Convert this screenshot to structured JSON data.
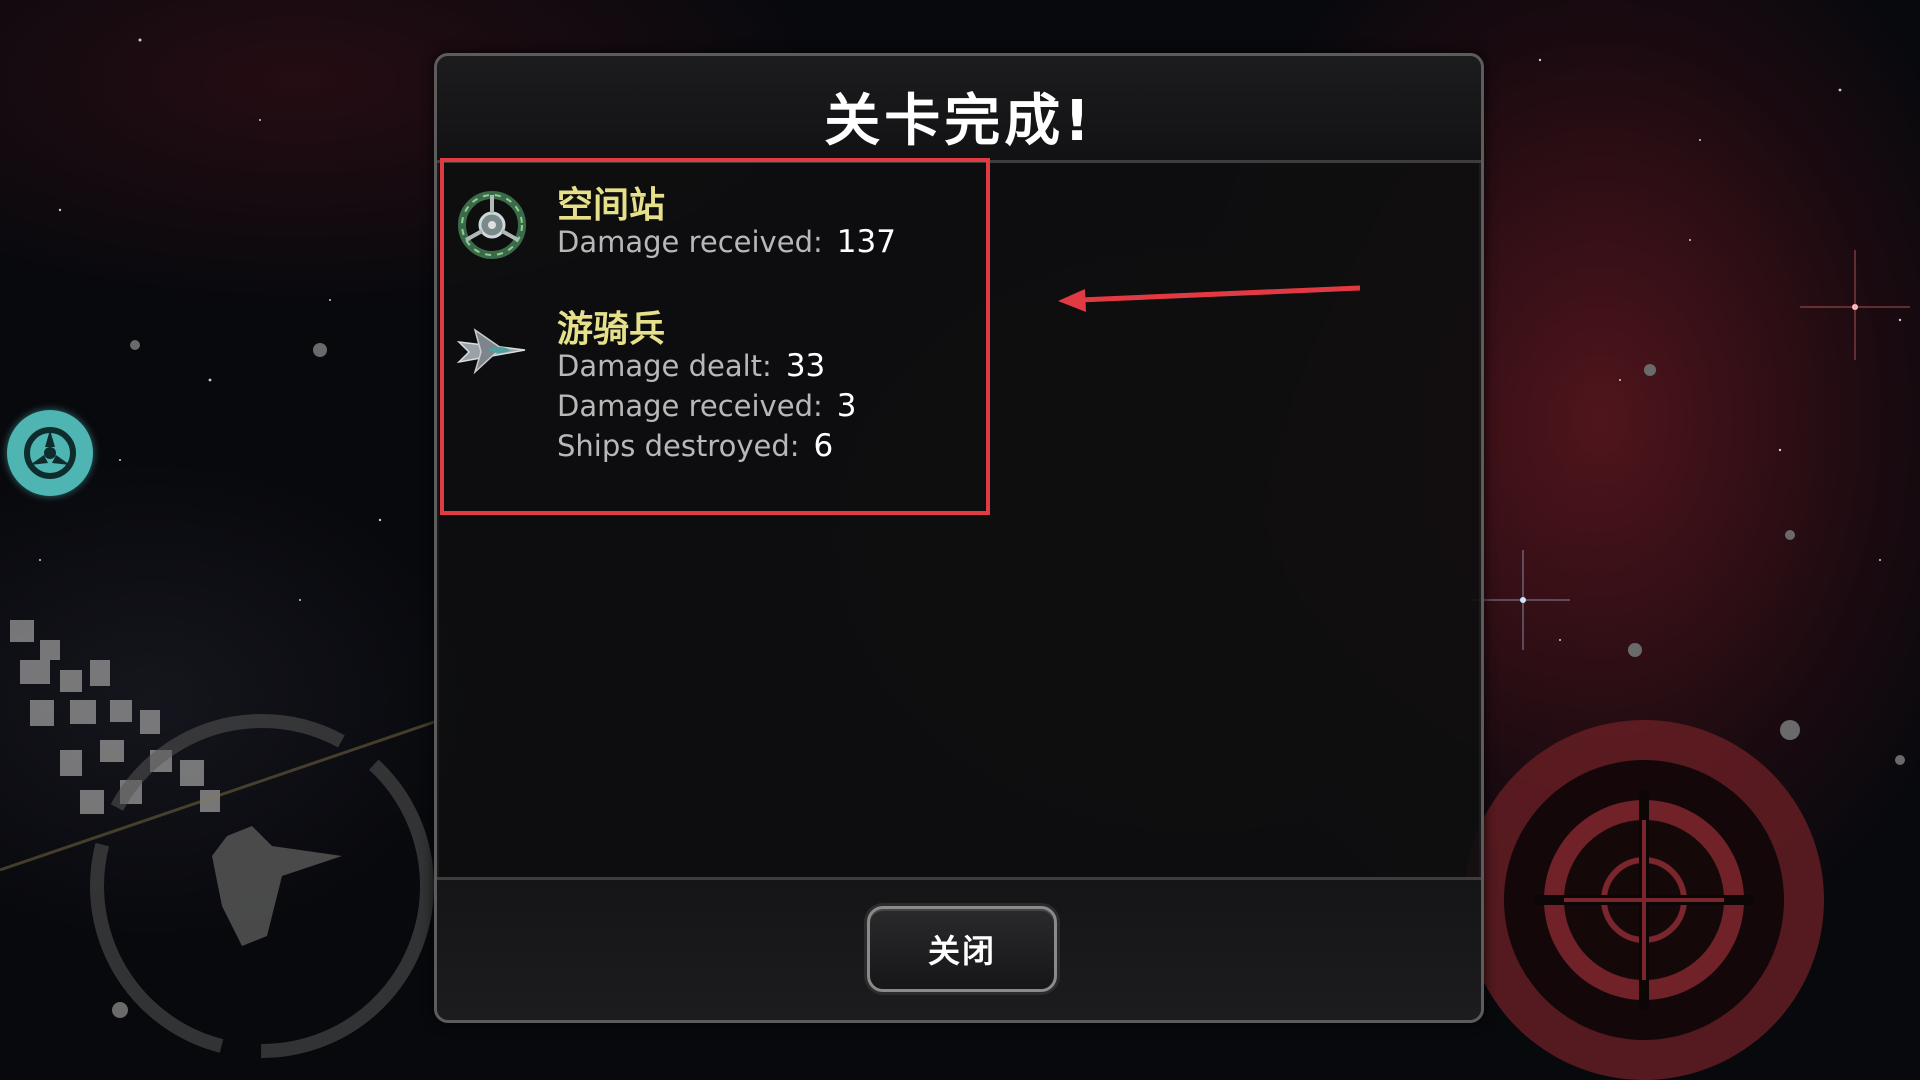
{
  "dialog": {
    "title": "关卡完成!",
    "close_label": "关闭"
  },
  "units": [
    {
      "name": "空间站",
      "icon": "space-station-icon",
      "stats": [
        {
          "label": "Damage received:",
          "value": "137"
        }
      ]
    },
    {
      "name": "游骑兵",
      "icon": "ranger-ship-icon",
      "stats": [
        {
          "label": "Damage dealt:",
          "value": "33"
        },
        {
          "label": "Damage received:",
          "value": "3"
        },
        {
          "label": "Ships destroyed:",
          "value": "6"
        }
      ]
    }
  ],
  "colors": {
    "unit_name": "#e6e08a",
    "highlight": "#e23a43",
    "side_button": "#4fb5b3",
    "fire_button": "#8a2a30"
  }
}
